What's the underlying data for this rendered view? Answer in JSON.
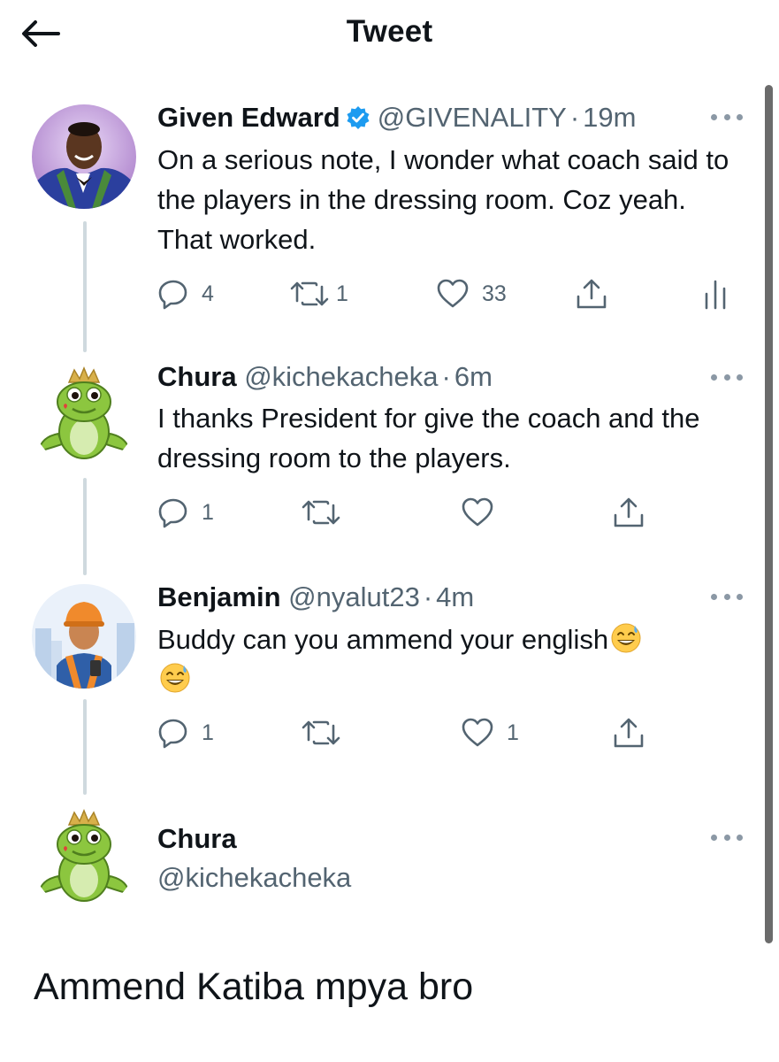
{
  "header": {
    "title": "Tweet"
  },
  "tweets": [
    {
      "name": "Given Edward",
      "verified": true,
      "handle": "@GIVENALITY",
      "sep": "·",
      "time": "19m",
      "text": "On a serious note, I wonder what coach said to the players in the dressing room. Coz yeah. That worked.",
      "counts": {
        "reply": "4",
        "retweet": "1",
        "like": "33"
      }
    },
    {
      "name": "Chura",
      "handle": "@kichekacheka",
      "sep": "·",
      "time": "6m",
      "text": "I thanks President for give the coach and the dressing room to the players.",
      "counts": {
        "reply": "1",
        "retweet": "",
        "like": ""
      }
    },
    {
      "name": "Benjamin",
      "handle": "@nyalut23",
      "sep": "·",
      "time": "4m",
      "text": "Buddy can you ammend your english",
      "counts": {
        "reply": "1",
        "retweet": "",
        "like": "1"
      }
    }
  ],
  "main_tweet": {
    "name": "Chura",
    "handle": "@kichekacheka",
    "text": "Ammend Katiba mpya bro"
  },
  "colors": {
    "accent": "#1d9bf0",
    "muted": "#536471",
    "thread": "#cfd9de"
  },
  "icons": [
    "back-arrow-icon",
    "verified-badge-icon",
    "more-icon",
    "reply-icon",
    "retweet-icon",
    "like-icon",
    "share-icon",
    "analytics-icon",
    "sweat-smile-emoji-icon"
  ]
}
